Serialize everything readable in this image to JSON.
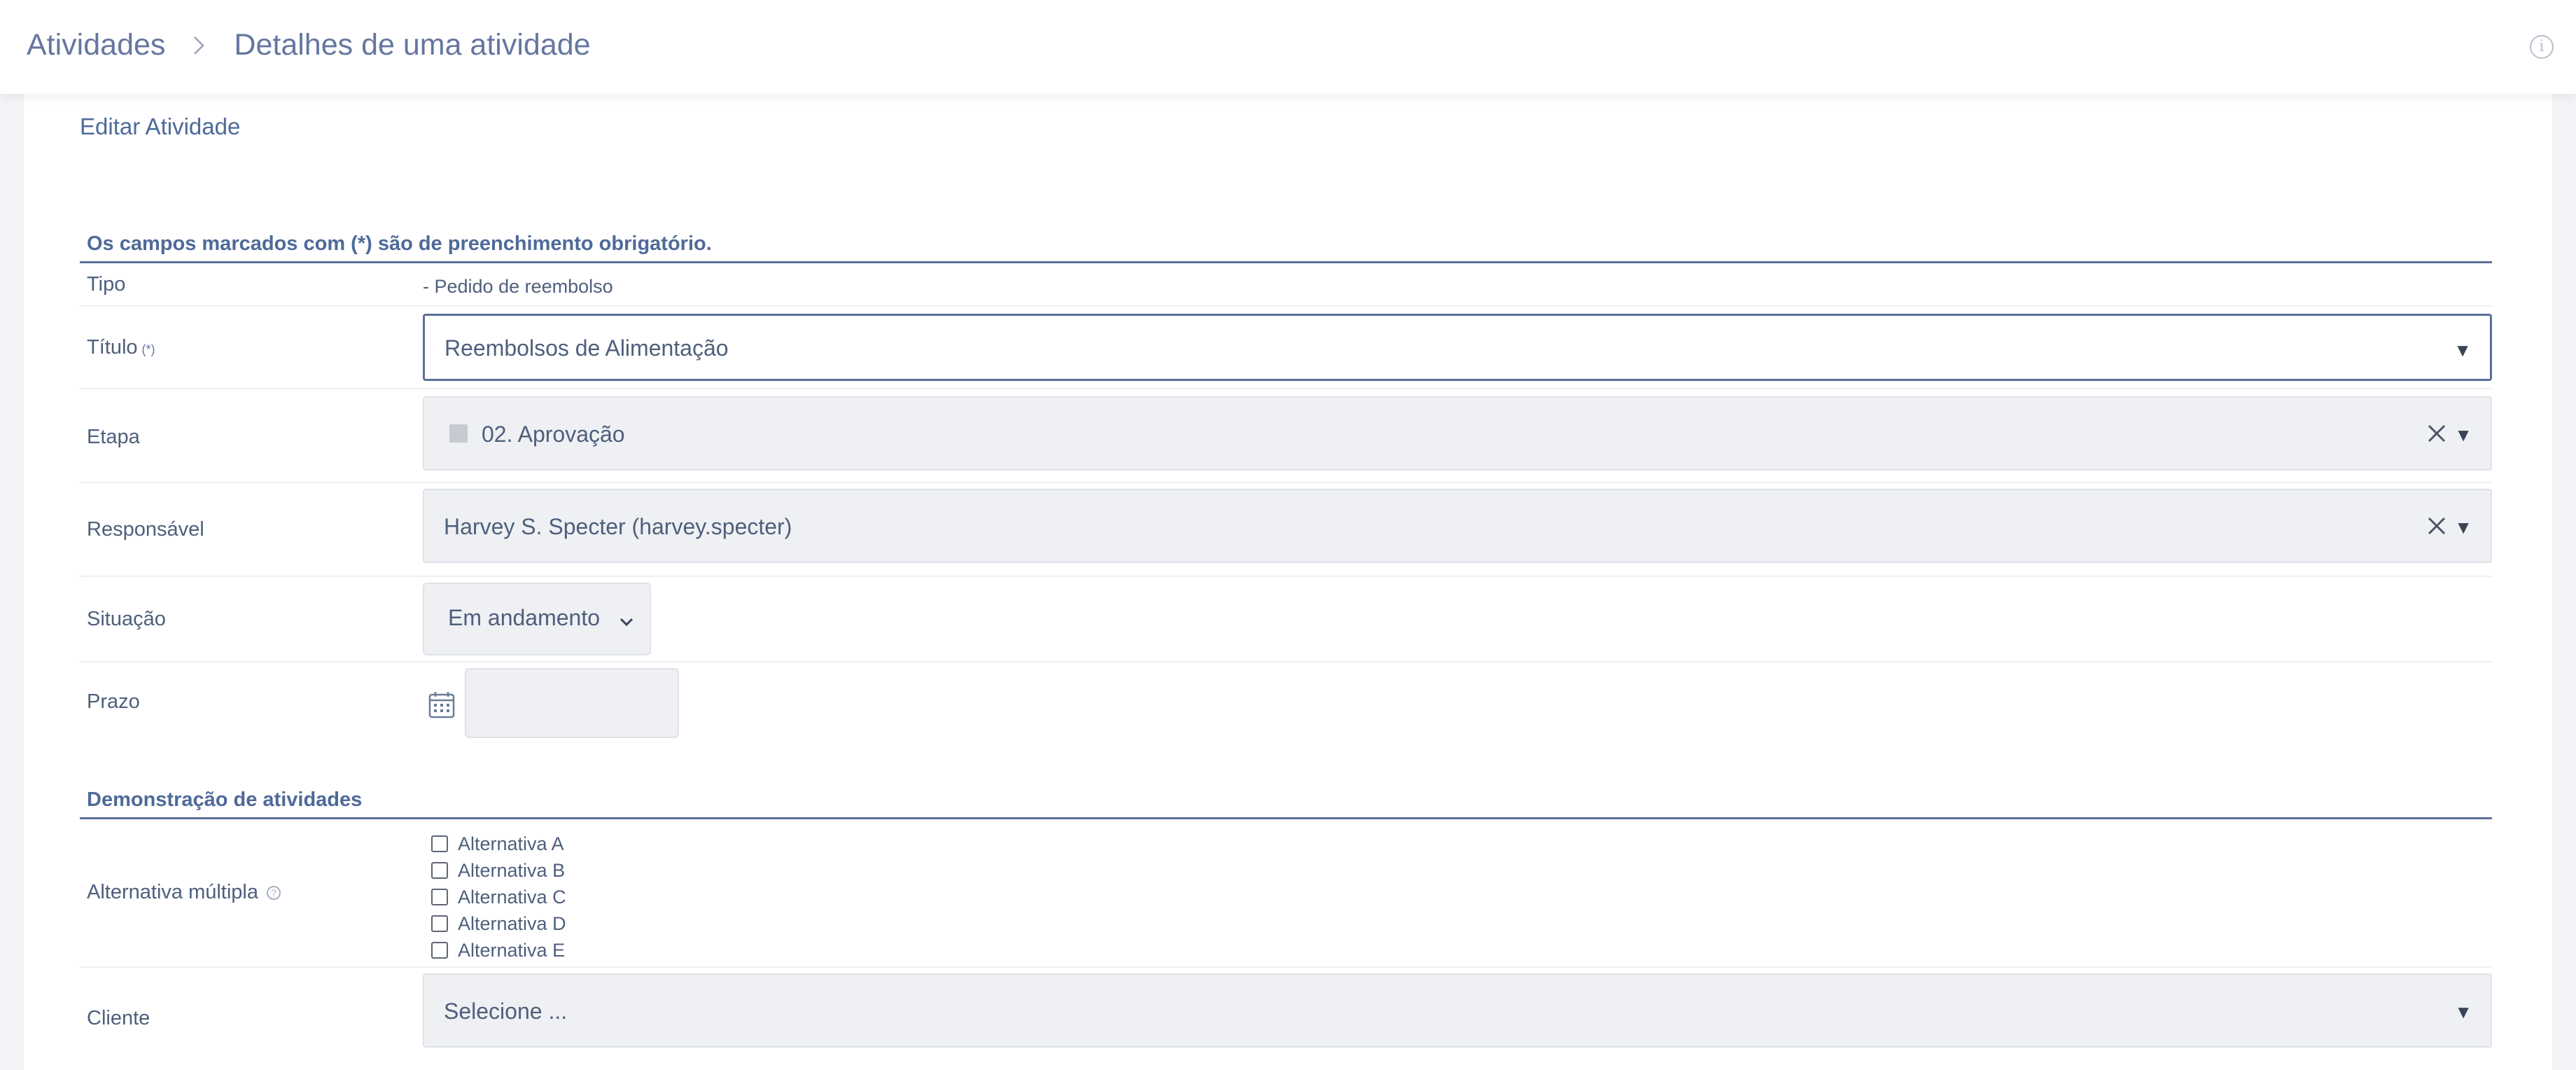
{
  "breadcrumb": {
    "root": "Atividades",
    "current": "Detalhes de uma atividade"
  },
  "panel": {
    "title": "Editar Atividade"
  },
  "form": {
    "required_note": "Os campos marcados com (*) são de preenchimento obrigatório.",
    "tipo": {
      "label": "Tipo",
      "value": "- Pedido de reembolso"
    },
    "titulo": {
      "label": "Título",
      "required_mark": "(*)",
      "value": "Reembolsos de Alimentação"
    },
    "etapa": {
      "label": "Etapa",
      "value": "02. Aprovação"
    },
    "responsavel": {
      "label": "Responsável",
      "value": "Harvey S. Specter (harvey.specter)"
    },
    "situacao": {
      "label": "Situação",
      "value": "Em andamento"
    },
    "prazo": {
      "label": "Prazo",
      "value": ""
    }
  },
  "demo": {
    "section_title": "Demonstração de atividades",
    "multiple": {
      "label": "Alternativa múltipla",
      "help_icon": "?",
      "options": [
        {
          "label": "Alternativa A",
          "checked": false
        },
        {
          "label": "Alternativa B",
          "checked": false
        },
        {
          "label": "Alternativa C",
          "checked": false
        },
        {
          "label": "Alternativa D",
          "checked": false
        },
        {
          "label": "Alternativa E",
          "checked": false
        }
      ]
    },
    "cliente": {
      "label": "Cliente",
      "placeholder": "Selecione ..."
    }
  },
  "icons": {
    "info": "info-icon",
    "clear": "close-icon",
    "calendar": "calendar-icon"
  },
  "colors": {
    "accent": "#5b6f9a",
    "field_bg": "#eef0f3",
    "text": "#4e5f7c"
  }
}
